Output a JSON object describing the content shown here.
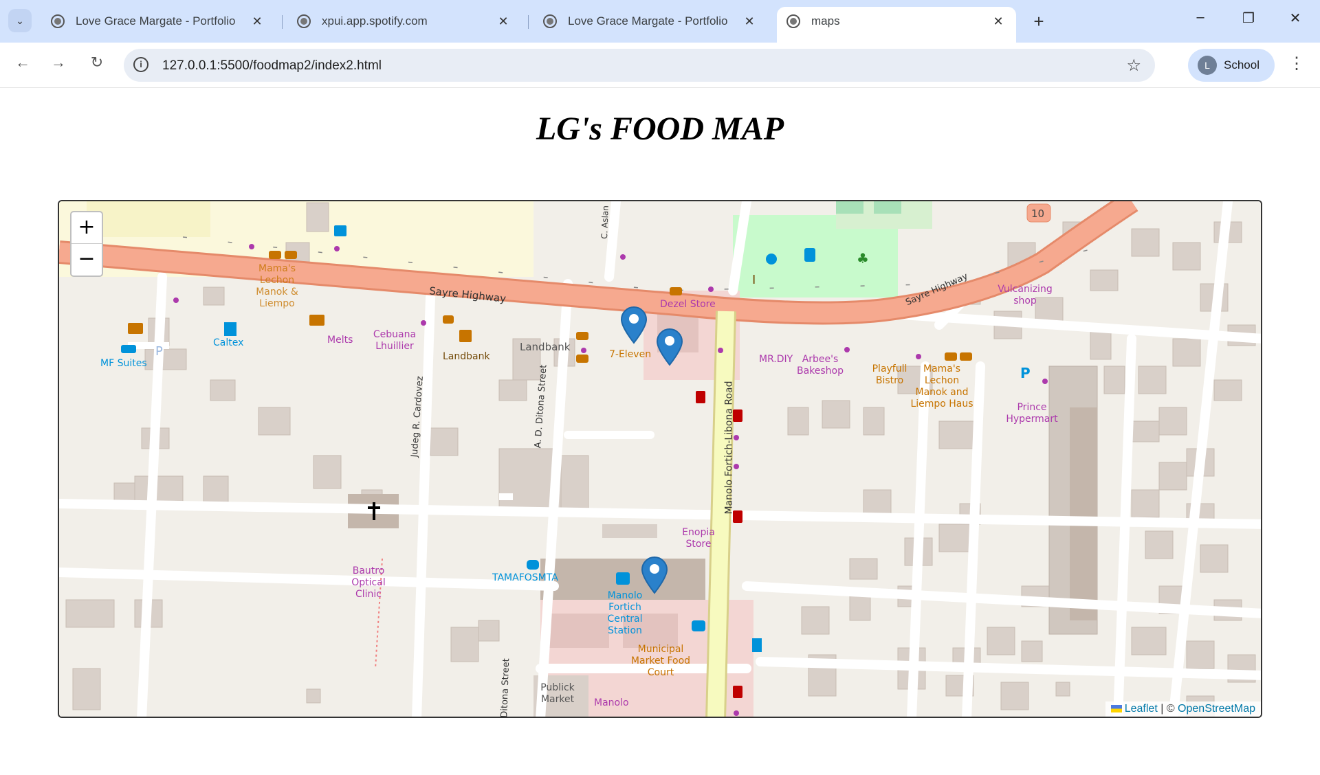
{
  "browser": {
    "tabs": [
      {
        "title": "Love Grace Margate - Portfolio",
        "close": "✕"
      },
      {
        "title": "xpui.app.spotify.com",
        "close": "✕"
      },
      {
        "title": "Love Grace Margate - Portfolio",
        "close": "✕"
      },
      {
        "title": "maps",
        "close": "✕"
      }
    ],
    "new_tab": "+",
    "window": {
      "minimize": "–",
      "restore": "❐",
      "close": "✕"
    },
    "url": "127.0.0.1:5500/foodmap2/index2.html",
    "profile": {
      "initial": "L",
      "name": "School"
    }
  },
  "page": {
    "title": "LG's FOOD MAP"
  },
  "map": {
    "zoom_in": "+",
    "zoom_out": "−",
    "attribution": {
      "leaflet": "Leaflet",
      "separator": " | © ",
      "osm": "OpenStreetMap"
    },
    "road_shield": "10",
    "roads": {
      "sayre1": "Sayre Highway",
      "sayre2": "Sayre Highway",
      "manolo": "Manolo Fortich-Libona Road",
      "judeg": "Judeg R. Cardovez",
      "ditona1": "A. D. Ditona Street",
      "ditona2": "Ditona Street",
      "aslan": "C. Aslan"
    },
    "places": {
      "mf_suites": "MF Suites",
      "caltex": "Caltex",
      "lechon_top": "Mama's Lechon Manok & Liempo",
      "melts": "Melts",
      "cebuana": "Cebuana Lhuillier",
      "landbank1": "Landbank",
      "landbank2": "Landbank",
      "seven_eleven": "7-Eleven",
      "dezel": "Dezel Store",
      "mr_diy": "MR.DIY",
      "arbees": "Arbee's Bakeshop",
      "playfull": "Playfull Bistro",
      "mamas": "Mama's Lechon Manok and Liempo Haus",
      "vulcanizing": "Vulcanizing shop",
      "prince": "Prince Hypermart",
      "enopia": "Enopia Store",
      "bautro": "Bautro Optical Clinic",
      "tamafosmta": "TAMAFOSMTA",
      "central": "Manolo Fortich Central Station",
      "municipal": "Municipal Market Food Court",
      "public": "Publick Market",
      "manolo": "Manolo"
    }
  }
}
